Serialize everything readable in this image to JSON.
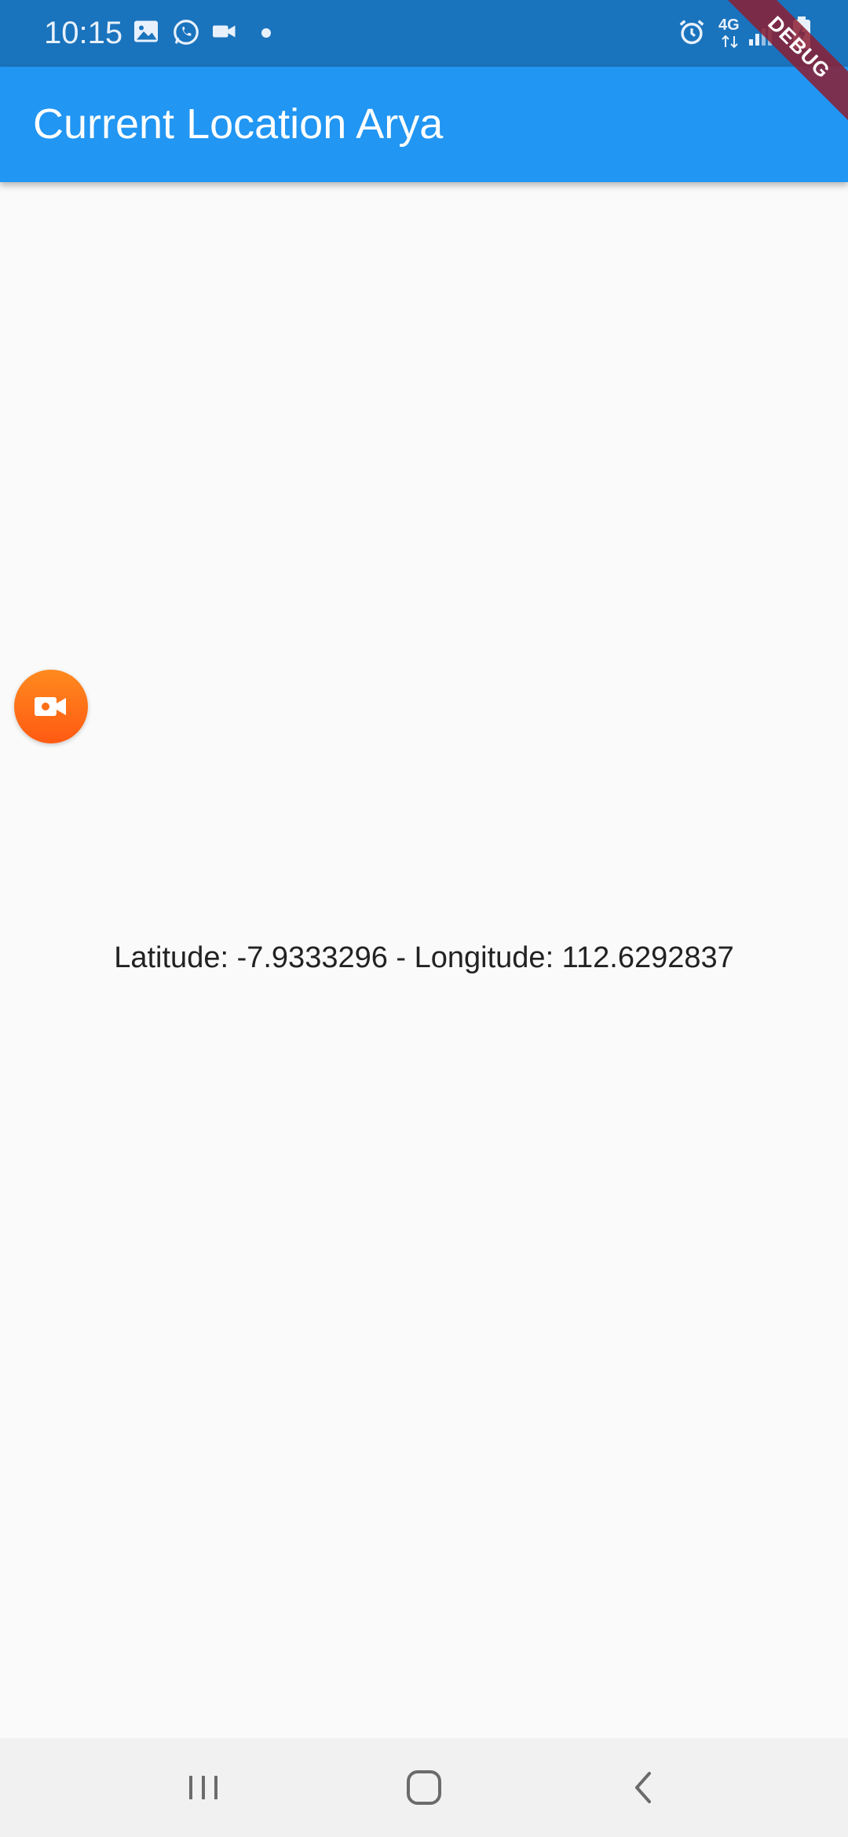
{
  "status_bar": {
    "time": "10:15",
    "network": "4G",
    "icons": [
      "image-icon",
      "whatsapp-icon",
      "video-camera-icon",
      "alarm-icon",
      "signal-icon",
      "battery-icon"
    ]
  },
  "debug_banner": "DEBUG",
  "app_bar": {
    "title": "Current Location Arya"
  },
  "body": {
    "location_text": "Latitude: -7.9333296 - Longitude: 112.6292837"
  },
  "screen_recorder": {
    "icon": "video-camera-icon",
    "color": "#ff6f17"
  },
  "nav_bar": {
    "buttons": [
      "recent-apps-icon",
      "home-icon",
      "back-icon"
    ]
  },
  "colors": {
    "status_bar": "#1a73bd",
    "app_bar": "#2196f3",
    "background": "#fafafa"
  }
}
